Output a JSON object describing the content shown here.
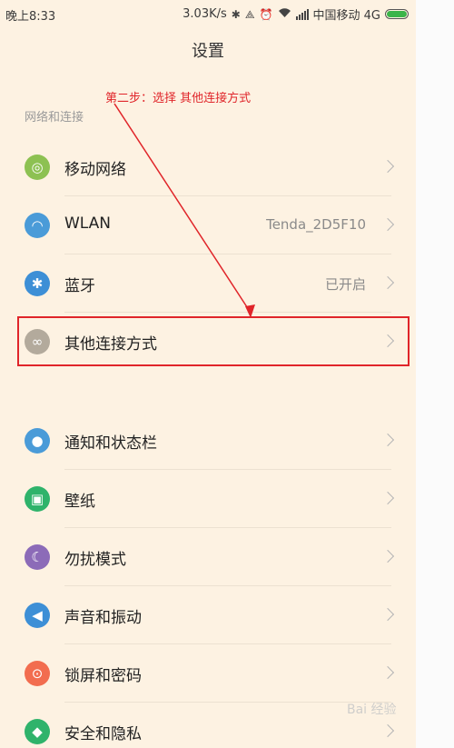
{
  "status_bar": {
    "time": "晚上8:33",
    "speed": "3.03K/s",
    "carrier": "中国移动 4G",
    "icons": [
      "bluetooth-icon",
      "vibrate-icon",
      "alarm-icon",
      "wifi-icon",
      "signal-icon",
      "battery-icon"
    ]
  },
  "header": {
    "title": "设置"
  },
  "annotation": {
    "text": "第二步：选择 其他连接方式",
    "color": "#e0252a"
  },
  "section": {
    "label": "网络和连接"
  },
  "items": [
    {
      "label": "移动网络",
      "value": "",
      "icon": "mobile-network-icon",
      "color": "#8dc152"
    },
    {
      "label": "WLAN",
      "value": "Tenda_2D5F10",
      "icon": "wifi-icon",
      "color": "#4a9bd8"
    },
    {
      "label": "蓝牙",
      "value": "已开启",
      "icon": "bluetooth-icon",
      "color": "#3d8fd6"
    },
    {
      "label": "其他连接方式",
      "value": "",
      "icon": "link-icon",
      "color": "#b3aa9c"
    },
    {
      "label": "通知和状态栏",
      "value": "",
      "icon": "notification-icon",
      "color": "#4a9bd8"
    },
    {
      "label": "壁纸",
      "value": "",
      "icon": "wallpaper-icon",
      "color": "#2fb36b"
    },
    {
      "label": "勿扰模式",
      "value": "",
      "icon": "moon-icon",
      "color": "#8c6bb8"
    },
    {
      "label": "声音和振动",
      "value": "",
      "icon": "sound-icon",
      "color": "#3d8fd6"
    },
    {
      "label": "锁屏和密码",
      "value": "",
      "icon": "lock-icon",
      "color": "#f26d4f"
    },
    {
      "label": "安全和隐私",
      "value": "",
      "icon": "shield-icon",
      "color": "#2fb36b"
    }
  ],
  "watermark": {
    "text": "Bai 经验"
  }
}
